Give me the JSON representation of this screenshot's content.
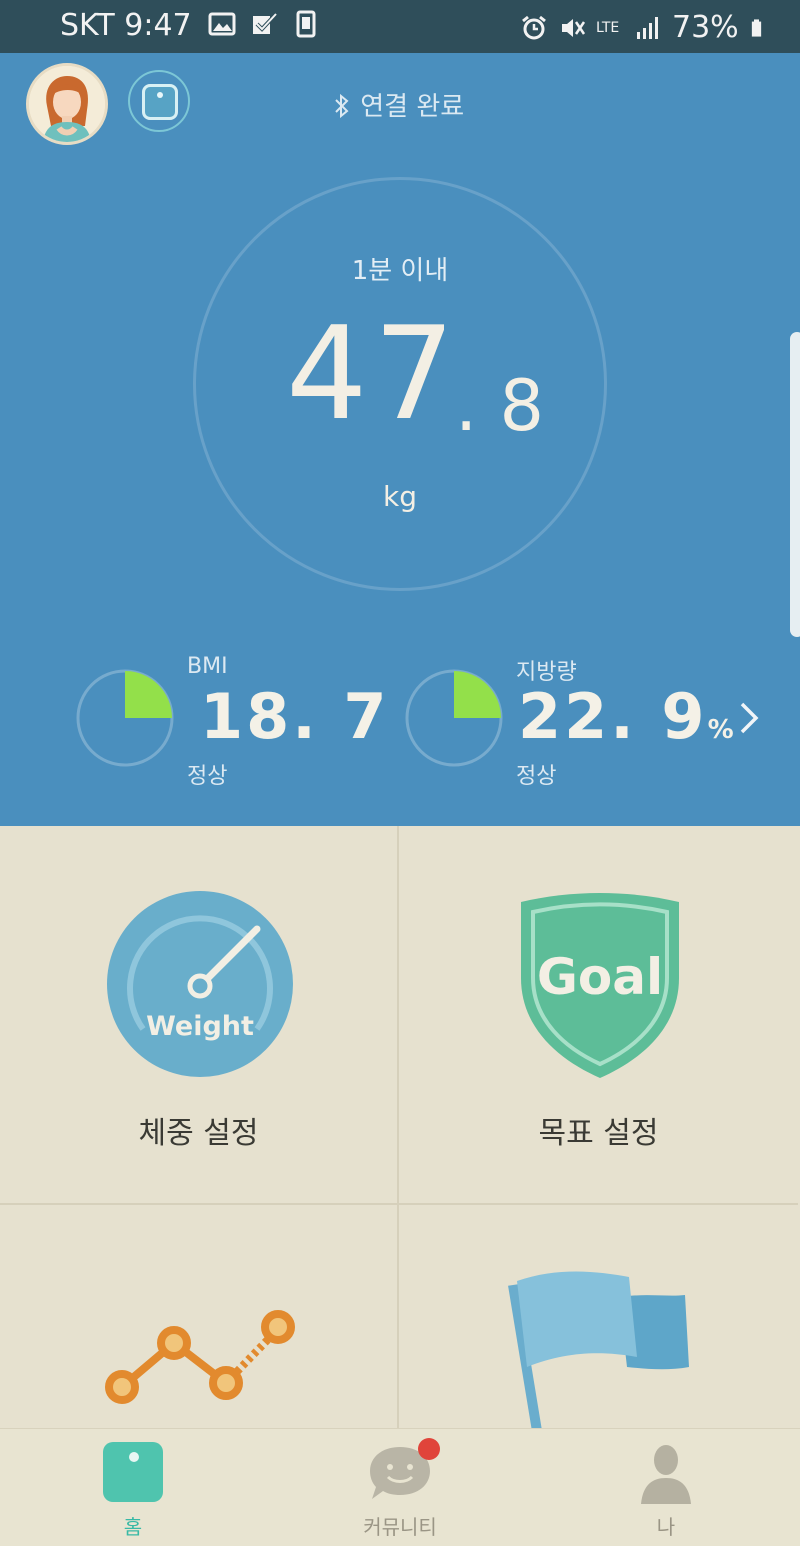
{
  "status_bar": {
    "carrier": "SKT",
    "time": "9:47",
    "network": "LTE",
    "battery": "73%",
    "icons": [
      "image-icon",
      "check-box-icon",
      "phone-outline-icon",
      "alarm-icon",
      "mute-icon",
      "lte-icon",
      "signal-icon",
      "battery-icon"
    ]
  },
  "header": {
    "connection_status": "연결 완료",
    "bluetooth_icon": "bluetooth-icon"
  },
  "measurement": {
    "time_label": "1분 이내",
    "weight_integer": "47",
    "weight_decimal": ". 8",
    "unit": "kg"
  },
  "stats": {
    "bmi": {
      "label": "BMI",
      "value": "18. 7",
      "status": "정상",
      "fill_fraction": 0.25
    },
    "fat": {
      "label": "지방량",
      "value": "22. 9",
      "unit": "%",
      "status": "정상",
      "fill_fraction": 0.25
    },
    "accent_color": "#93e04a"
  },
  "tiles": [
    {
      "label": "체중 설정",
      "icon": "weight-gauge-icon",
      "icon_text": "Weight"
    },
    {
      "label": "목표 설정",
      "icon": "goal-shield-icon",
      "icon_text": "Goal"
    },
    {
      "label": "",
      "icon": "trend-chart-icon"
    },
    {
      "label": "",
      "icon": "flag-icon"
    }
  ],
  "bottom_nav": {
    "items": [
      {
        "label": "홈",
        "active": true
      },
      {
        "label": "커뮤니티",
        "active": false
      },
      {
        "label": "나",
        "active": false
      }
    ],
    "active_color": "#38b9a5"
  }
}
